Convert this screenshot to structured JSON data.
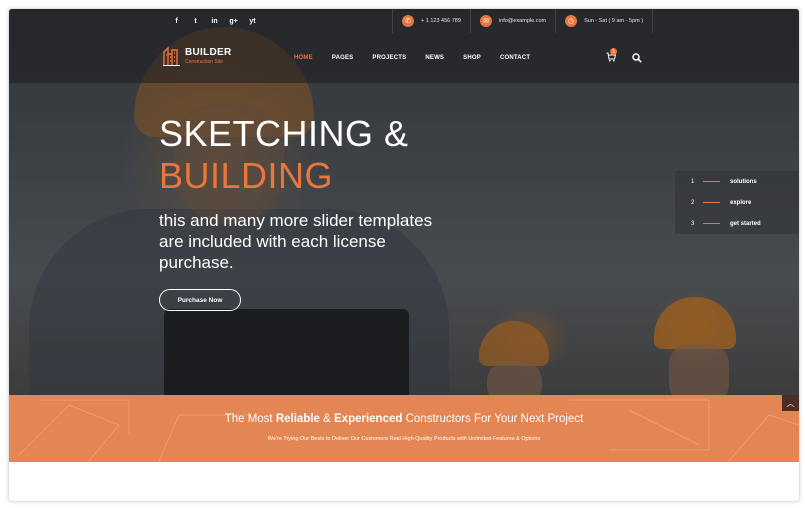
{
  "topbar": {
    "social": [
      "f",
      "t",
      "in",
      "g+",
      "yt"
    ],
    "phone": "+ 1 123 456 789",
    "email": "info@example.com",
    "hours": "Sun - Sat ( 9 am - 5pm )"
  },
  "logo": {
    "name": "BUILDER",
    "subtitle": "Construction Site"
  },
  "nav": {
    "items": [
      "HOME",
      "PAGES",
      "PROJECTS",
      "NEWS",
      "SHOP",
      "CONTACT"
    ],
    "active": "HOME",
    "cart_count": "1"
  },
  "hero": {
    "line1": "SKETCHING &",
    "line2": "BUILDING",
    "subtext": "this and many more slider templates are included with each license purchase.",
    "button": "Purchase Now"
  },
  "steps": [
    {
      "num": "1",
      "label": "solutions"
    },
    {
      "num": "2",
      "label": "explore"
    },
    {
      "num": "3",
      "label": "get started"
    }
  ],
  "band": {
    "title_parts": [
      "The Most ",
      "Reliable",
      " & ",
      "Experienced",
      " Constructors For Your Next Project"
    ],
    "subtitle": "We're Trying Our Bests to Deliver Our Customers Real High Quality Products with Unlimited Features & Options"
  },
  "colors": {
    "accent": "#e9763d",
    "band": "#e38654",
    "dark": "#1e1e20"
  }
}
